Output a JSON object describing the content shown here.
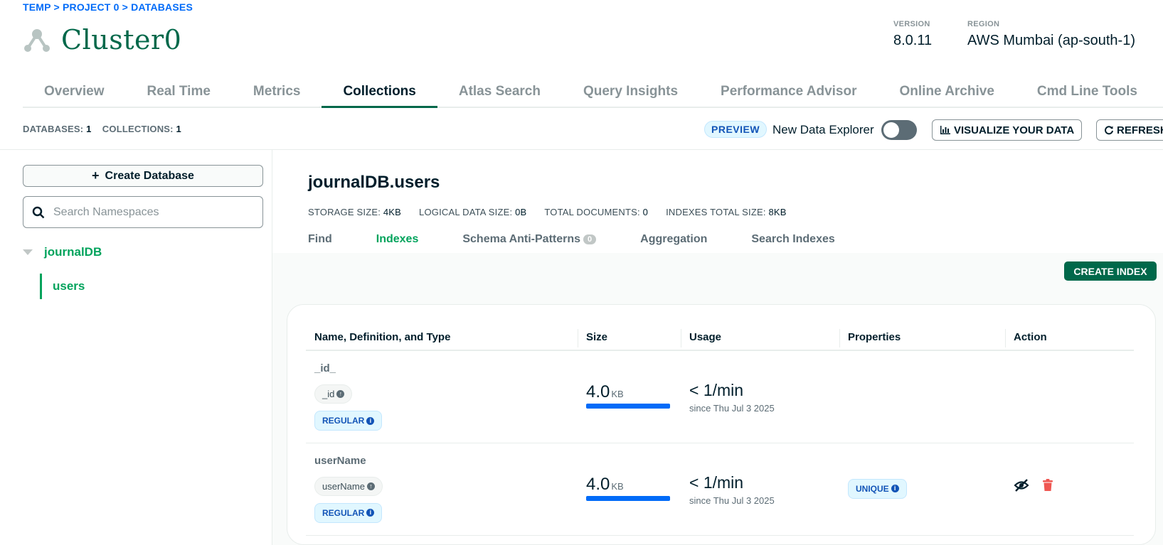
{
  "breadcrumb": "TEMP > PROJECT 0 > DATABASES",
  "cluster": {
    "name": "Cluster0",
    "icon": "cluster-icon"
  },
  "meta": {
    "version_label": "VERSION",
    "version": "8.0.11",
    "region_label": "REGION",
    "region": "AWS Mumbai (ap-south-1)"
  },
  "tabs": [
    "Overview",
    "Real Time",
    "Metrics",
    "Collections",
    "Atlas Search",
    "Query Insights",
    "Performance Advisor",
    "Online Archive",
    "Cmd Line Tools"
  ],
  "active_tab": "Collections",
  "stats": {
    "databases_label": "DATABASES:",
    "databases": "1",
    "collections_label": "COLLECTIONS:",
    "collections": "1"
  },
  "toolbar": {
    "preview": "PREVIEW",
    "new_data_explorer": "New Data Explorer",
    "visualize": "VISUALIZE YOUR DATA",
    "refresh": "REFRESH"
  },
  "sidebar": {
    "create_db": "Create Database",
    "search_placeholder": "Search Namespaces",
    "database": "journalDB",
    "collection": "users"
  },
  "namespace": {
    "title": "journalDB.users",
    "storage_label": "STORAGE SIZE:",
    "storage": "4KB",
    "logical_label": "LOGICAL DATA SIZE:",
    "logical": "0B",
    "docs_label": "TOTAL DOCUMENTS:",
    "docs": "0",
    "indexes_label": "INDEXES TOTAL SIZE:",
    "indexes": "8KB"
  },
  "sub_tabs": [
    "Find",
    "Indexes",
    "Schema Anti-Patterns",
    "Aggregation",
    "Search Indexes"
  ],
  "anti_patterns_count": "0",
  "create_index": "CREATE INDEX",
  "table": {
    "headers": [
      "Name, Definition, and Type",
      "Size",
      "Usage",
      "Properties",
      "Action"
    ],
    "rows": [
      {
        "name": "_id_",
        "field": "_id",
        "type": "REGULAR",
        "size": "4.0",
        "unit": "KB",
        "usage": "< 1/min",
        "since": "since Thu Jul 3 2025",
        "property": ""
      },
      {
        "name": "userName",
        "field": "userName",
        "type": "REGULAR",
        "size": "4.0",
        "unit": "KB",
        "usage": "< 1/min",
        "since": "since Thu Jul 3 2025",
        "property": "UNIQUE"
      }
    ]
  },
  "colors": {
    "brand_green": "#00684a",
    "accent_green": "#00a35c",
    "link_blue": "#016bf8",
    "danger": "#ef5752"
  }
}
